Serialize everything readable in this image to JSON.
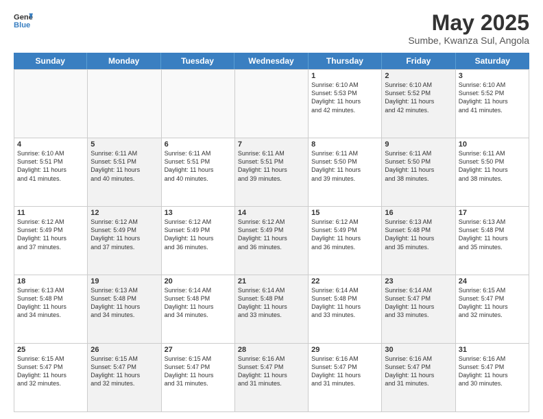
{
  "header": {
    "logo_line1": "General",
    "logo_line2": "Blue",
    "month": "May 2025",
    "location": "Sumbe, Kwanza Sul, Angola"
  },
  "weekdays": [
    "Sunday",
    "Monday",
    "Tuesday",
    "Wednesday",
    "Thursday",
    "Friday",
    "Saturday"
  ],
  "weeks": [
    [
      {
        "day": "",
        "info": "",
        "shaded": false,
        "empty": true
      },
      {
        "day": "",
        "info": "",
        "shaded": false,
        "empty": true
      },
      {
        "day": "",
        "info": "",
        "shaded": false,
        "empty": true
      },
      {
        "day": "",
        "info": "",
        "shaded": false,
        "empty": true
      },
      {
        "day": "1",
        "info": "Sunrise: 6:10 AM\nSunset: 5:53 PM\nDaylight: 11 hours\nand 42 minutes.",
        "shaded": false,
        "empty": false
      },
      {
        "day": "2",
        "info": "Sunrise: 6:10 AM\nSunset: 5:52 PM\nDaylight: 11 hours\nand 42 minutes.",
        "shaded": true,
        "empty": false
      },
      {
        "day": "3",
        "info": "Sunrise: 6:10 AM\nSunset: 5:52 PM\nDaylight: 11 hours\nand 41 minutes.",
        "shaded": false,
        "empty": false
      }
    ],
    [
      {
        "day": "4",
        "info": "Sunrise: 6:10 AM\nSunset: 5:51 PM\nDaylight: 11 hours\nand 41 minutes.",
        "shaded": false,
        "empty": false
      },
      {
        "day": "5",
        "info": "Sunrise: 6:11 AM\nSunset: 5:51 PM\nDaylight: 11 hours\nand 40 minutes.",
        "shaded": true,
        "empty": false
      },
      {
        "day": "6",
        "info": "Sunrise: 6:11 AM\nSunset: 5:51 PM\nDaylight: 11 hours\nand 40 minutes.",
        "shaded": false,
        "empty": false
      },
      {
        "day": "7",
        "info": "Sunrise: 6:11 AM\nSunset: 5:51 PM\nDaylight: 11 hours\nand 39 minutes.",
        "shaded": true,
        "empty": false
      },
      {
        "day": "8",
        "info": "Sunrise: 6:11 AM\nSunset: 5:50 PM\nDaylight: 11 hours\nand 39 minutes.",
        "shaded": false,
        "empty": false
      },
      {
        "day": "9",
        "info": "Sunrise: 6:11 AM\nSunset: 5:50 PM\nDaylight: 11 hours\nand 38 minutes.",
        "shaded": true,
        "empty": false
      },
      {
        "day": "10",
        "info": "Sunrise: 6:11 AM\nSunset: 5:50 PM\nDaylight: 11 hours\nand 38 minutes.",
        "shaded": false,
        "empty": false
      }
    ],
    [
      {
        "day": "11",
        "info": "Sunrise: 6:12 AM\nSunset: 5:49 PM\nDaylight: 11 hours\nand 37 minutes.",
        "shaded": false,
        "empty": false
      },
      {
        "day": "12",
        "info": "Sunrise: 6:12 AM\nSunset: 5:49 PM\nDaylight: 11 hours\nand 37 minutes.",
        "shaded": true,
        "empty": false
      },
      {
        "day": "13",
        "info": "Sunrise: 6:12 AM\nSunset: 5:49 PM\nDaylight: 11 hours\nand 36 minutes.",
        "shaded": false,
        "empty": false
      },
      {
        "day": "14",
        "info": "Sunrise: 6:12 AM\nSunset: 5:49 PM\nDaylight: 11 hours\nand 36 minutes.",
        "shaded": true,
        "empty": false
      },
      {
        "day": "15",
        "info": "Sunrise: 6:12 AM\nSunset: 5:49 PM\nDaylight: 11 hours\nand 36 minutes.",
        "shaded": false,
        "empty": false
      },
      {
        "day": "16",
        "info": "Sunrise: 6:13 AM\nSunset: 5:48 PM\nDaylight: 11 hours\nand 35 minutes.",
        "shaded": true,
        "empty": false
      },
      {
        "day": "17",
        "info": "Sunrise: 6:13 AM\nSunset: 5:48 PM\nDaylight: 11 hours\nand 35 minutes.",
        "shaded": false,
        "empty": false
      }
    ],
    [
      {
        "day": "18",
        "info": "Sunrise: 6:13 AM\nSunset: 5:48 PM\nDaylight: 11 hours\nand 34 minutes.",
        "shaded": false,
        "empty": false
      },
      {
        "day": "19",
        "info": "Sunrise: 6:13 AM\nSunset: 5:48 PM\nDaylight: 11 hours\nand 34 minutes.",
        "shaded": true,
        "empty": false
      },
      {
        "day": "20",
        "info": "Sunrise: 6:14 AM\nSunset: 5:48 PM\nDaylight: 11 hours\nand 34 minutes.",
        "shaded": false,
        "empty": false
      },
      {
        "day": "21",
        "info": "Sunrise: 6:14 AM\nSunset: 5:48 PM\nDaylight: 11 hours\nand 33 minutes.",
        "shaded": true,
        "empty": false
      },
      {
        "day": "22",
        "info": "Sunrise: 6:14 AM\nSunset: 5:48 PM\nDaylight: 11 hours\nand 33 minutes.",
        "shaded": false,
        "empty": false
      },
      {
        "day": "23",
        "info": "Sunrise: 6:14 AM\nSunset: 5:47 PM\nDaylight: 11 hours\nand 33 minutes.",
        "shaded": true,
        "empty": false
      },
      {
        "day": "24",
        "info": "Sunrise: 6:15 AM\nSunset: 5:47 PM\nDaylight: 11 hours\nand 32 minutes.",
        "shaded": false,
        "empty": false
      }
    ],
    [
      {
        "day": "25",
        "info": "Sunrise: 6:15 AM\nSunset: 5:47 PM\nDaylight: 11 hours\nand 32 minutes.",
        "shaded": false,
        "empty": false
      },
      {
        "day": "26",
        "info": "Sunrise: 6:15 AM\nSunset: 5:47 PM\nDaylight: 11 hours\nand 32 minutes.",
        "shaded": true,
        "empty": false
      },
      {
        "day": "27",
        "info": "Sunrise: 6:15 AM\nSunset: 5:47 PM\nDaylight: 11 hours\nand 31 minutes.",
        "shaded": false,
        "empty": false
      },
      {
        "day": "28",
        "info": "Sunrise: 6:16 AM\nSunset: 5:47 PM\nDaylight: 11 hours\nand 31 minutes.",
        "shaded": true,
        "empty": false
      },
      {
        "day": "29",
        "info": "Sunrise: 6:16 AM\nSunset: 5:47 PM\nDaylight: 11 hours\nand 31 minutes.",
        "shaded": false,
        "empty": false
      },
      {
        "day": "30",
        "info": "Sunrise: 6:16 AM\nSunset: 5:47 PM\nDaylight: 11 hours\nand 31 minutes.",
        "shaded": true,
        "empty": false
      },
      {
        "day": "31",
        "info": "Sunrise: 6:16 AM\nSunset: 5:47 PM\nDaylight: 11 hours\nand 30 minutes.",
        "shaded": false,
        "empty": false
      }
    ]
  ]
}
